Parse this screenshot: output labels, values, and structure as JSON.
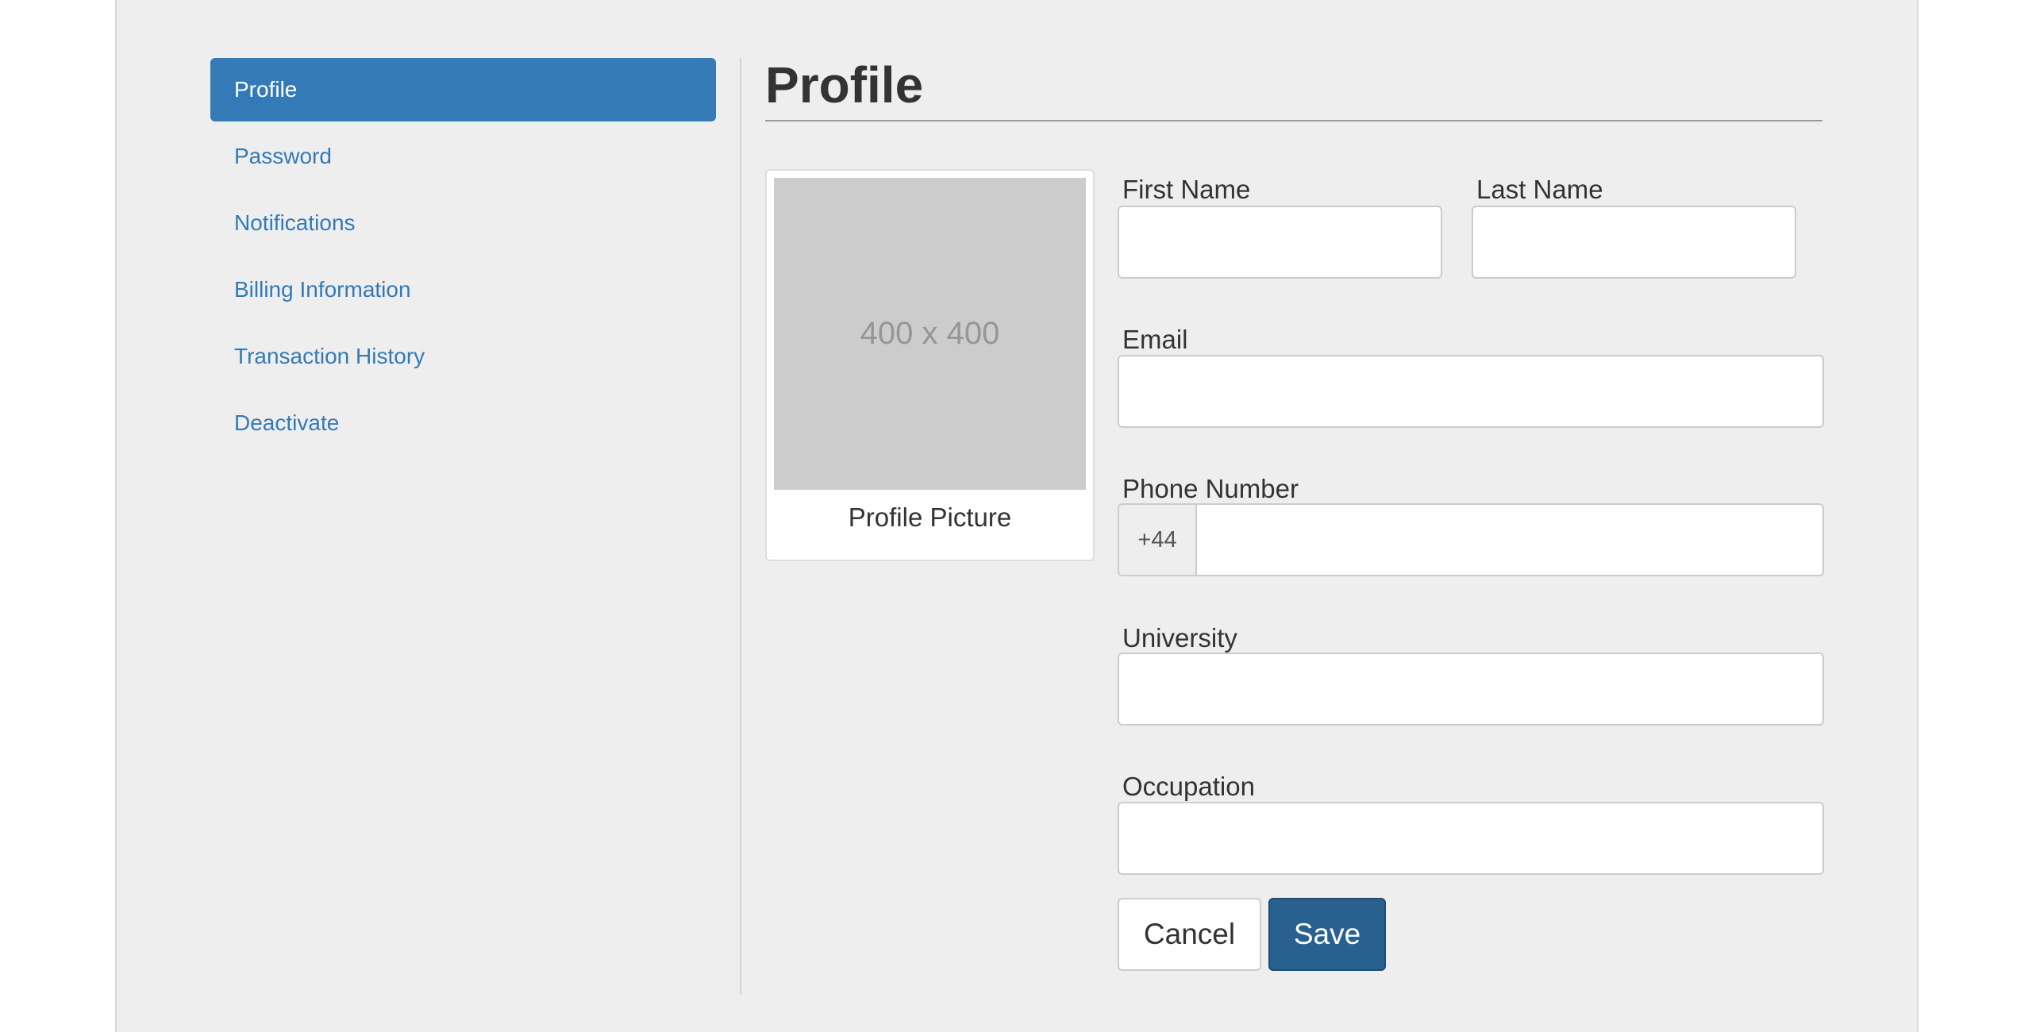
{
  "sidebar": {
    "items": [
      {
        "label": "Profile",
        "active": true
      },
      {
        "label": "Password"
      },
      {
        "label": "Notifications"
      },
      {
        "label": "Billing Information"
      },
      {
        "label": "Transaction History"
      },
      {
        "label": "Deactivate"
      }
    ]
  },
  "main": {
    "title": "Profile",
    "picture": {
      "placeholder_text": "400 x 400",
      "caption": "Profile Picture"
    },
    "form": {
      "first_name_label": "First Name",
      "last_name_label": "Last Name",
      "email_label": "Email",
      "phone_label": "Phone Number",
      "phone_prefix": "+44",
      "university_label": "University",
      "occupation_label": "Occupation",
      "first_name_value": "",
      "last_name_value": "",
      "email_value": "",
      "phone_value": "",
      "university_value": "",
      "occupation_value": ""
    },
    "buttons": {
      "cancel_label": "Cancel",
      "save_label": "Save"
    }
  },
  "colors": {
    "accent": "#337ab7",
    "save_button": "#286090",
    "panel_background": "#eeeeee"
  }
}
